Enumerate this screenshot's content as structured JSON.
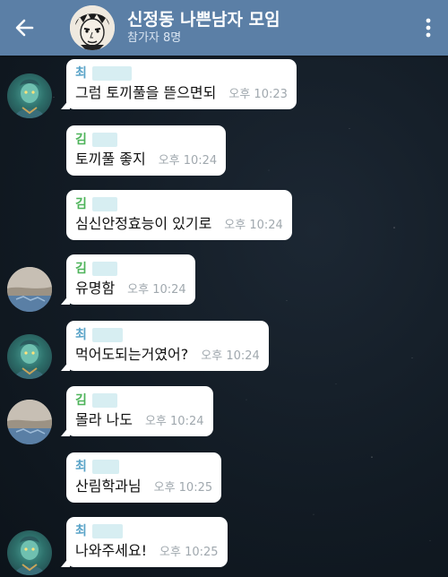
{
  "header": {
    "title": "신정동 나쁜남자 모임",
    "subtitle": "참가자 8명"
  },
  "colors": {
    "header_bg": "#5b7fa6",
    "sender_choi": "#5ba4c8",
    "sender_kim": "#4fb45b",
    "bubble": "#ffffff",
    "time": "#a0a8ae"
  },
  "messages": [
    {
      "sender": "최",
      "text": "그럼 토끼풀을 뜯으면되",
      "time": "오후 10:23"
    },
    {
      "sender": "김",
      "text": "토끼풀 좋지",
      "time": "오후 10:24"
    },
    {
      "sender": "김",
      "text": "심신안정효능이 있기로",
      "time": "오후 10:24"
    },
    {
      "sender": "김",
      "text": "유명함",
      "time": "오후 10:24"
    },
    {
      "sender": "최",
      "text": "먹어도되는거였어?",
      "time": "오후 10:24"
    },
    {
      "sender": "김",
      "text": "몰라 나도",
      "time": "오후 10:24"
    },
    {
      "sender": "최",
      "text": "산림학과님",
      "time": "오후 10:25"
    },
    {
      "sender": "최",
      "text": "나와주세요!",
      "time": "오후 10:25"
    }
  ]
}
